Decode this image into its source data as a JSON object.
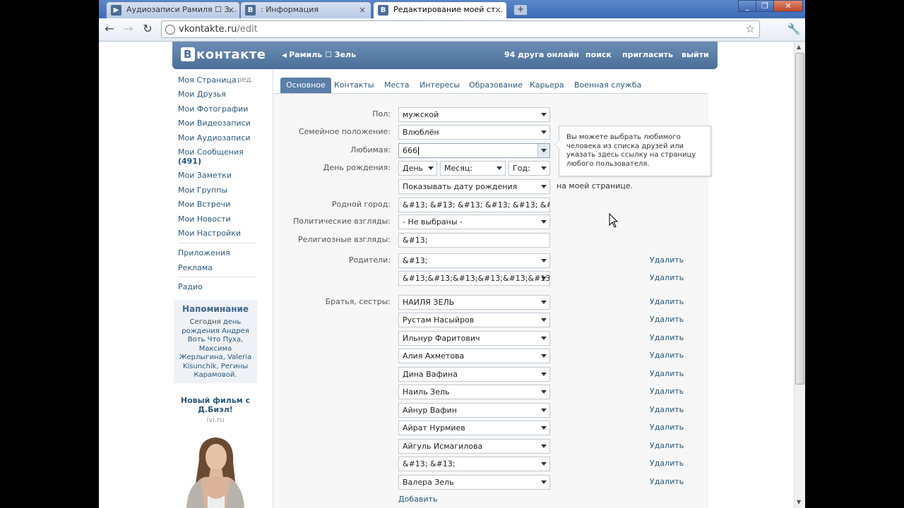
{
  "browser": {
    "tabs": [
      {
        "label": "Аудиозаписи Рамиля ☐ З...",
        "favicon": "play-icon",
        "color": "#4a6b8f"
      },
      {
        "label": ": Информация",
        "favicon": "vk-icon",
        "color": "#4b6e98"
      },
      {
        "label": "Редактирование моей ст...",
        "favicon": "vk-icon",
        "color": "#4b6e98"
      }
    ],
    "url_host": "vkontakte.ru",
    "url_path": "/edit"
  },
  "header": {
    "logo": "контакте",
    "logo_letter": "В",
    "user": "Рамиль ☐ Зель",
    "friends_online": "94 друга онлайн",
    "search": "поиск",
    "invite": "пригласить",
    "logout": "выйти"
  },
  "left_menu": {
    "my_page": "Моя Страница",
    "edit": "ред.",
    "items": [
      "Мои Друзья",
      "Мои Фотографии",
      "Мои Видеозаписи",
      "Мои Аудиозаписи",
      "Мои Сообщения"
    ],
    "messages_count": "(491)",
    "items2": [
      "Мои Заметки",
      "Мои Группы",
      "Мои Встречи",
      "Мои Новости",
      "Мои Настройки"
    ],
    "items3": [
      "Приложения",
      "Реклама"
    ],
    "items4": [
      "Радио"
    ]
  },
  "reminder": {
    "title": "Напоминание",
    "text_pre": "Сегодня",
    "text_link": "день рождения",
    "names": "Андрея Воть Что Пуха, Максима Жерлыгина, Valeria Kisunchik, Регины Карамовой."
  },
  "ad": {
    "title": "Новый фильм с Д.Биэл!",
    "source": "ivi.ru"
  },
  "profile_tabs": [
    "Основное",
    "Контакты",
    "Места",
    "Интересы",
    "Образование",
    "Карьера",
    "Военная служба"
  ],
  "form": {
    "gender_label": "Пол:",
    "gender": "мужской",
    "marital_label": "Семейное положение:",
    "marital": "Влюблён",
    "beloved_label": "Любимая:",
    "beloved": "666",
    "birthday_label": "День рождения:",
    "day": "День",
    "month": "Месяц:",
    "year": "Год:",
    "show_birthday": "Показывать дату рождения",
    "on_my_page": "на моей странице.",
    "hometown_label": "Родной город:",
    "hometown": "&#13; &#13; &#13; &#13; &#13; &#13; &",
    "political_label": "Политические взгляды:",
    "political": "- Не выбраны -",
    "religion_label": "Религиозные взгляды:",
    "religion": "&#13;",
    "parents_label": "Родители:",
    "parents": [
      "&#13;",
      "&#13;&#13;&#13;&#13;&#13;&#13;&"
    ],
    "siblings_label": "Братья, сестры:",
    "siblings": [
      "НАИЛЯ ЗЕЛЬ",
      "Рустам Насыйров",
      "Ильнур Фаритович",
      "Алия Ахметова",
      "Дина Вафина",
      "Наиль Зель",
      "Айнур Вафин",
      "Айрат Нурмиев",
      "Айгуль Исмагилова",
      "&#13; &#13;",
      "Валера Зель"
    ],
    "delete": "Удалить",
    "add": "Добавить"
  },
  "tooltip": "Вы можете выбрать любимого человека из списка друзей или указать здесь ссылку на страницу любого пользователя."
}
